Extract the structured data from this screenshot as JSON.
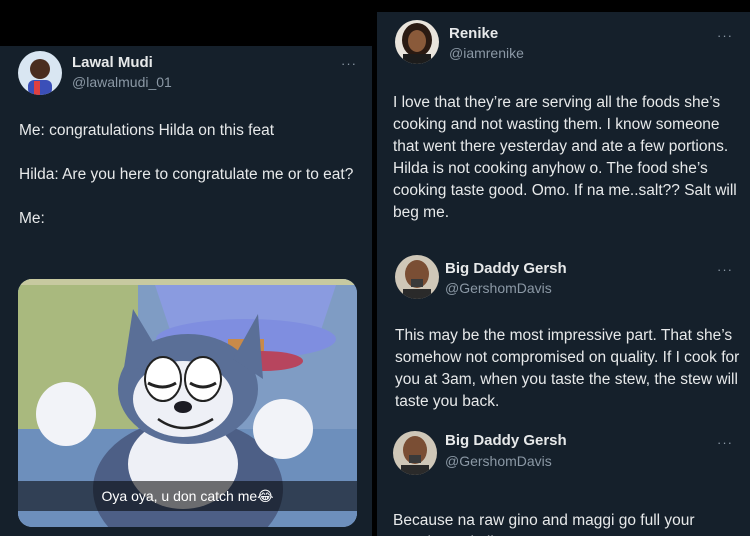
{
  "left_tweet": {
    "name": "Lawal Mudi",
    "handle": "@lawalmudi_01",
    "more": "···",
    "lines": [
      "Me: congratulations Hilda on this feat",
      "Hilda: Are you here to congratulate me or to eat?",
      "Me:"
    ],
    "meme_caption": "Oya oya, u don catch me😂"
  },
  "right_tweets": [
    {
      "name": "Renike",
      "handle": "@iamrenike",
      "more": "···",
      "text": "I love that they’re are serving all the foods she’s cooking and not wasting them. I know someone that went there yesterday and ate a few portions. Hilda is not cooking anyhow o. The food she’s cooking taste good. Omo. If na me..salt?? Salt will beg me."
    },
    {
      "name": "Big Daddy Gersh",
      "handle": "@GershomDavis",
      "more": "···",
      "text": "This may be the most impressive part. That she’s somehow not compromised on quality. If I cook for you at 3am, when you taste the stew, the stew will taste you back."
    },
    {
      "name": "Big Daddy Gersh",
      "handle": "@GershomDavis",
      "more": "···",
      "text": "Because na raw gino and maggi go full your mouth. God plis"
    }
  ],
  "colors": {
    "background": "#15202b",
    "text": "#e7e9ea",
    "secondary": "#8b98a5"
  }
}
